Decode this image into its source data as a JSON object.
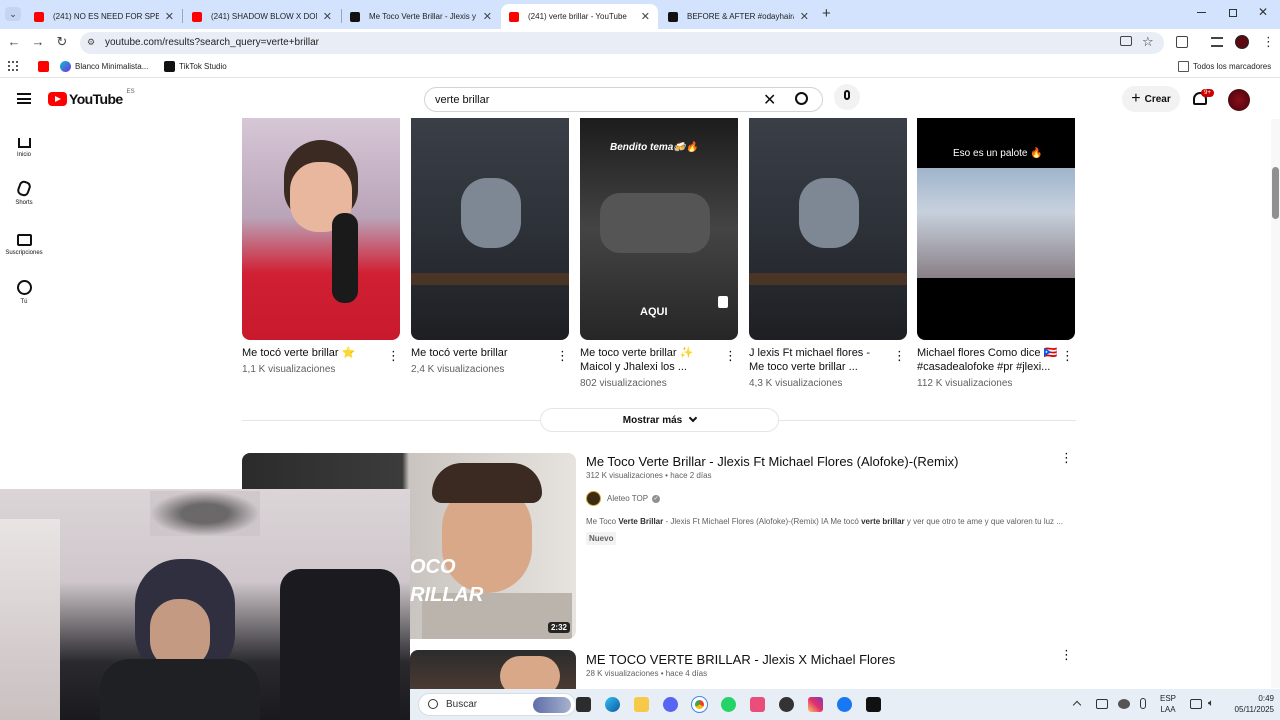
{
  "browser": {
    "tabs": [
      {
        "title": "(241) NO ES NEED FOR SPEED",
        "favicon": "youtube-icon",
        "active": false
      },
      {
        "title": "(241) SHADOW BLOW X DON",
        "favicon": "youtube-icon",
        "active": false
      },
      {
        "title": "Me Toco Verte Brillar - Jlexis y",
        "favicon": "tiktok-icon",
        "active": false
      },
      {
        "title": "(241) verte brillar - YouTube",
        "favicon": "youtube-icon",
        "active": true
      },
      {
        "title": "BEFORE & AFTER #odayhairand",
        "favicon": "tiktok-icon",
        "active": false
      }
    ],
    "url": "youtube.com/results?search_query=verte+brillar",
    "bookmarks": [
      {
        "label": "",
        "icon": "youtube-icon"
      },
      {
        "label": "Blanco Minimalista...",
        "icon": "canva-icon"
      },
      {
        "label": "TikTok Studio",
        "icon": "tiktok-icon"
      }
    ],
    "all_bookmarks_label": "Todos los marcadores"
  },
  "youtube": {
    "logo_text": "YouTube",
    "region": "ES",
    "search_value": "verte brillar",
    "create_label": "Crear",
    "notif_badge": "9+",
    "guide": [
      {
        "label": "Inicio",
        "icon": "home-icon"
      },
      {
        "label": "Shorts",
        "icon": "shorts-icon"
      },
      {
        "label": "Suscripciones",
        "icon": "subscriptions-icon"
      },
      {
        "label": "Tú",
        "icon": "you-icon"
      }
    ],
    "shorts": [
      {
        "title_line1": "Me tocó verte brillar ⭐",
        "title_line2": "",
        "views": "1,1 K visualizaciones",
        "overlay": ""
      },
      {
        "title_line1": "Me tocó verte brillar",
        "title_line2": "",
        "views": "2,4 K visualizaciones",
        "overlay": ""
      },
      {
        "title_line1": "Me toco verte brillar ✨",
        "title_line2": "Maicol y Jhalexi los ...",
        "views": "802 visualizaciones",
        "overlay": "Bendito tema🍻🔥"
      },
      {
        "title_line1": "J lexis Ft michael flores -",
        "title_line2": "Me toco verte brillar ...",
        "views": "4,3 K visualizaciones",
        "overlay": ""
      },
      {
        "title_line1": "Michael flores Como dice 🇵🇷",
        "title_line2": "#casadealofoke #pr #jlexi...",
        "views": "112 K visualizaciones",
        "overlay": "Eso es un palote 🔥"
      }
    ],
    "show_more_label": "Mostrar más",
    "results": [
      {
        "title": "Me Toco Verte Brillar - Jlexis Ft Michael Flores (Alofoke)-(Remix)",
        "views": "312 K visualizaciones",
        "age": "hace 2 días",
        "channel": "Aleteo TOP",
        "verified": true,
        "desc_prefix": "Me Toco ",
        "desc_bold1": "Verte Brillar",
        "desc_mid": " - Jlexis Ft Michael Flores (Alofoke)-(Remix) IA Me tocó ",
        "desc_bold2": "verte brillar",
        "desc_suffix": " y ver que otro te ame y que valoren tu luz ...",
        "badge": "Nuevo",
        "duration": "2:32",
        "thumb_text": "OCO\nRILLAR"
      },
      {
        "title": "ME TOCO VERTE BRILLAR - Jlexis X Michael Flores",
        "views": "28 K visualizaciones",
        "age": "hace 4 días"
      }
    ]
  },
  "taskbar": {
    "search_placeholder": "Buscar",
    "lang_line1": "ESP",
    "lang_line2": "LAA",
    "time": "0:49",
    "date": "05/11/2025"
  }
}
